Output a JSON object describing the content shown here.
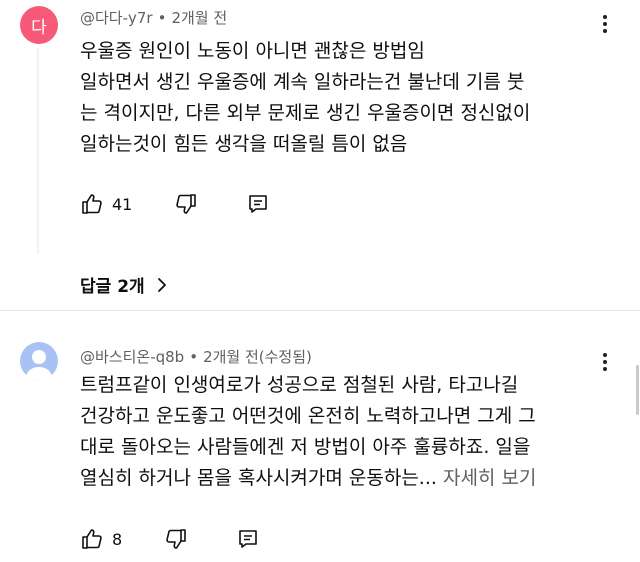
{
  "comments": [
    {
      "avatar_letter": "다",
      "avatar_color": "#f65a78",
      "handle": "@다다-y7r",
      "separator": "•",
      "time": "2개월 전",
      "body_lines": [
        "우울증 원인이 노동이 아니면 괜찮은 방법임",
        "일하면서 생긴 우울증에 계속 일하라는건 불난데 기름 붓",
        "는 격이지만, 다른 외부 문제로 생긴 우울증이면 정신없이",
        "일하는것이 힘든 생각을 떠올릴 틈이 없음"
      ],
      "like_count": "41",
      "icons": {
        "like": "thumb-up-icon",
        "dislike": "thumb-down-icon",
        "reply": "reply-icon",
        "more": "more-vertical-icon"
      }
    },
    {
      "avatar_color": "#a8c3f3",
      "handle": "@바스티온-q8b",
      "separator": "•",
      "time": "2개월 전(수정됨)",
      "body_lines": [
        "트럼프같이 인생여로가 성공으로 점철된 사람, 타고나길",
        "건강하고 운도좋고 어떤것에 온전히 노력하고나면 그게 그",
        "대로 돌아오는 사람들에겐 저 방법이 아주 훌륭하죠. 일을",
        "열심히 하거나 몸을 혹사시켜가며 운동하는..."
      ],
      "read_more": "자세히 보기",
      "like_count": "8",
      "icons": {
        "like": "thumb-up-icon",
        "dislike": "thumb-down-icon",
        "reply": "reply-icon",
        "more": "more-vertical-icon"
      }
    }
  ],
  "replies_toggle": {
    "label": "답글 2개",
    "icon": "chevron-right-icon"
  }
}
